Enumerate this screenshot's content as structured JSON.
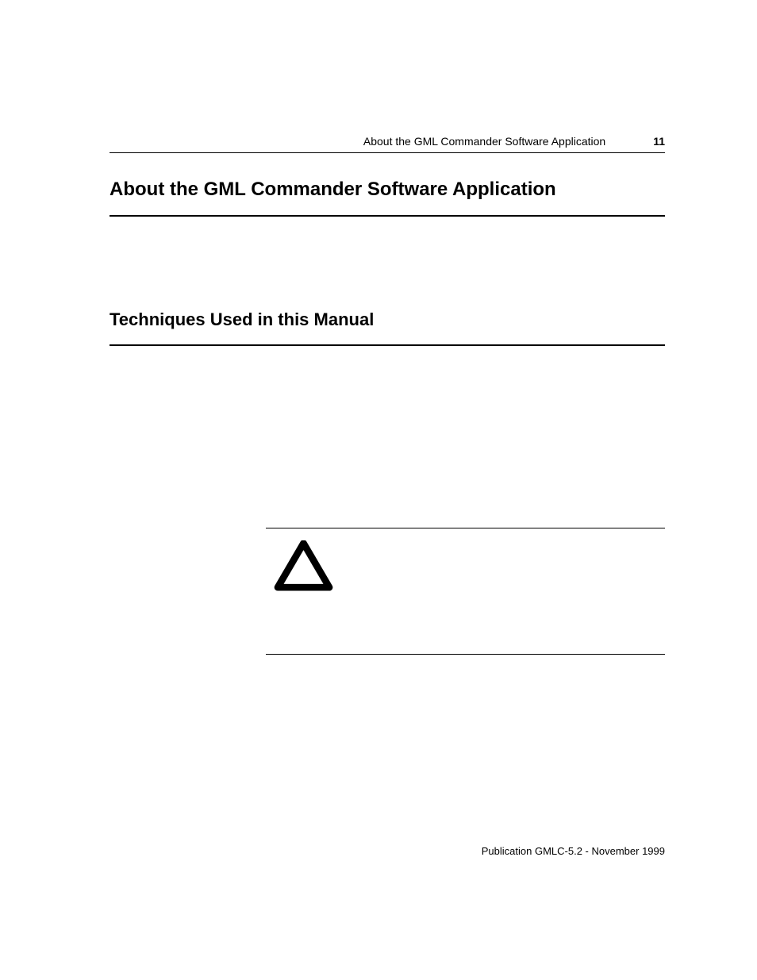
{
  "header": {
    "running_title": "About the GML Commander Software Application",
    "page_number": "11"
  },
  "main_heading": "About the GML Commander Software Application",
  "sub_heading": "Techniques Used in this Manual",
  "footer": "Publication GMLC-5.2 - November 1999"
}
